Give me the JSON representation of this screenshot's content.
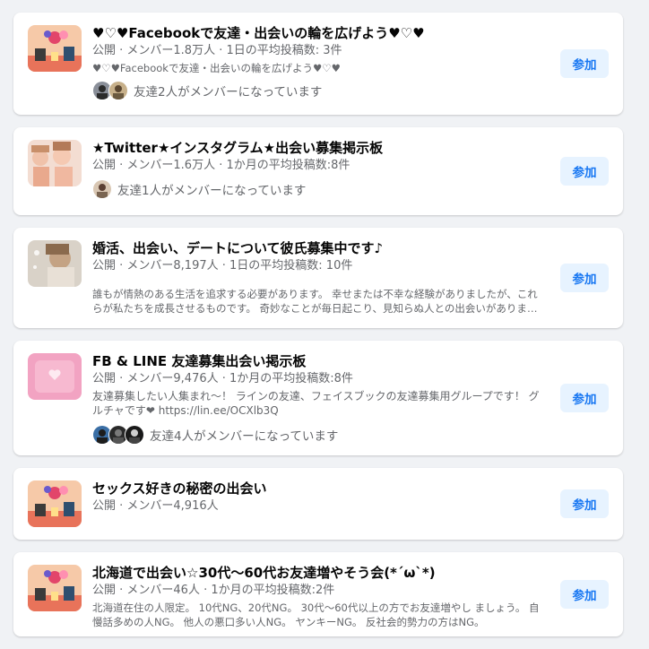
{
  "groups": [
    {
      "title": "♥♡♥Facebookで友達・出会いの輪を広げよう♥♡♥",
      "meta": "公開 · メンバー1.8万人 · 1日の平均投稿数: 3件",
      "description": "♥♡♥Facebookで友達・出会いの輪を広げよう♥♡♥",
      "friends_text": "友達2人がメンバーになっています",
      "join_label": "参加"
    },
    {
      "title": "★Twitter★インスタグラム★出会い募集掲示板",
      "meta": "公開 · メンバー1.6万人 · 1か月の平均投稿数:8件",
      "friends_text": "友達1人がメンバーになっています",
      "join_label": "参加"
    },
    {
      "title": "婚活、出会い、デートについて彼氏募集中です♪",
      "meta": "公開 · メンバー8,197人 · 1日の平均投稿数: 10件",
      "description": "誰もが情熱のある生活を追求する必要があります。 幸せまたは不幸な経験がありましたが、これらが私たちを成長させるものです。 奇妙なことが毎日起こり、見知らぬ人との出会いがあります。",
      "join_label": "参加"
    },
    {
      "title": "FB & LINE 友達募集出会い掲示板",
      "meta": "公開 · メンバー9,476人 · 1か月の平均投稿数:8件",
      "description": "友達募集したい人集まれ〜！ ラインの友達、フェイスブックの友達募集用グループです！ グルチャです❤ https://lin.ee/OCXlb3Q",
      "friends_text": "友達4人がメンバーになっています",
      "join_label": "参加"
    },
    {
      "title": "セックス好きの秘密の出会い",
      "meta": "公開 · メンバー4,916人",
      "join_label": "参加"
    },
    {
      "title": "北海道で出会い☆30代〜60代お友達増やそう会(*´ω`*)",
      "meta": "公開 · メンバー46人 · 1か月の平均投稿数:2件",
      "description": "北海道在住の人限定。 10代NG、20代NG。 30代〜60代以上の方でお友達増やし ましょう。 自慢話多めの人NG。 他人の悪口多い人NG。 ヤンキーNG。 反社会的勢力の方はNG。",
      "join_label": "参加"
    }
  ]
}
